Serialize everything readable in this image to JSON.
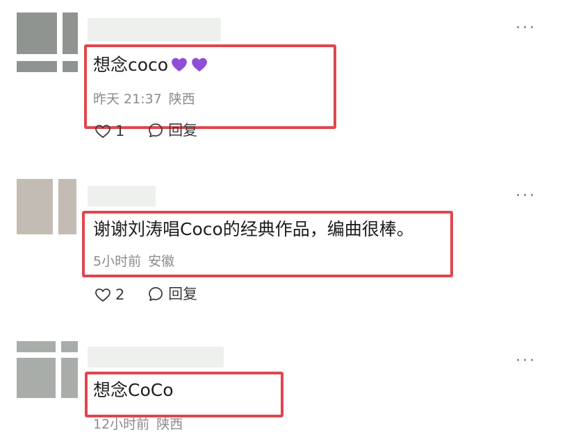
{
  "comments": [
    {
      "content": "想念coco",
      "emojis": [
        "purple-heart",
        "purple-heart"
      ],
      "time": "昨天 21:37",
      "location": "陕西",
      "likes": "1",
      "reply_label": "回复"
    },
    {
      "content": "谢谢刘涛唱Coco的经典作品，编曲很棒。",
      "time": "5小时前",
      "location": "安徽",
      "likes": "2",
      "reply_label": "回复"
    },
    {
      "content": "想念CoCo",
      "time": "12小时前",
      "location": "陕西"
    }
  ],
  "colors": {
    "highlight": "#e0464e",
    "emoji_heart": "#8e4fd6",
    "meta_text": "#8a8a8a"
  },
  "icons": {
    "more": "more-dots-icon",
    "like": "heart-outline-icon",
    "reply": "speech-bubble-icon"
  }
}
